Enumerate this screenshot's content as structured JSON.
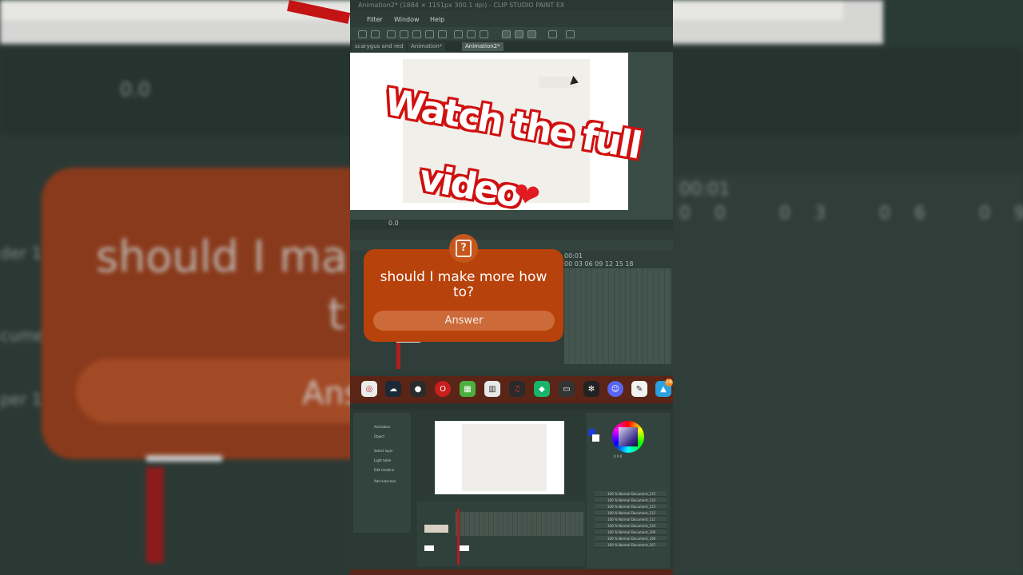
{
  "window": {
    "title": "Animation2* (1884 × 1151px 300.1 dpi) - CLIP STUDIO PAINT EX"
  },
  "menu": [
    "Filter",
    "Window",
    "Help"
  ],
  "tabs": [
    {
      "label": "scarygus and red",
      "active": false
    },
    {
      "label": "Animation*",
      "active": false
    },
    {
      "label": "Animation2*",
      "active": true
    }
  ],
  "overlay": {
    "headline_line1": "Watch the full",
    "headline_line2": "video",
    "heart": "❤"
  },
  "question": {
    "text": "should I make more how to?",
    "answer_label": "Answer",
    "icon": "question-mark-icon"
  },
  "timeline": {
    "time_label": "00:01",
    "ticks": "00 03 06 09 12 15 18",
    "zoom_value": "0.0"
  },
  "background": {
    "question_text_line1": "should I ma",
    "question_text_line2": "t",
    "answer_label": "Ans",
    "ticks": "00 03 06 09 12 15 18",
    "time_label": "00:01",
    "layer_label_1": "der 1",
    "layer_label_2": "cumen",
    "layer_label_3": "per 1",
    "zoom_value": "0.0"
  },
  "taskbar": {
    "icons": [
      "opera-gx-icon",
      "steam-icon",
      "obs-icon",
      "opera-icon",
      "minecraft-icon",
      "app-icon",
      "headphones-icon",
      "greenapp-icon",
      "monitor-icon",
      "resolve-icon",
      "discord-icon",
      "clip-studio-icon",
      "app-badge-icon"
    ],
    "badge_count": "18"
  },
  "mini": {
    "left_rows": [
      "Animation",
      "Object",
      "Select layer",
      "Light table",
      "Edit timeline",
      "Add auto-tool"
    ],
    "layers": [
      "100 % Normal Document_115",
      "100 % Normal Document_114",
      "100 % Normal Document_113",
      "100 % Normal Document_112",
      "100 % Normal Document_111",
      "100 % Normal Document_110",
      "100 % Normal Document_109",
      "100 % Normal Document_108",
      "100 % Normal Document_107"
    ],
    "color_values": "0 0 0"
  },
  "colors": {
    "bubble": "#b8420b",
    "bubble_button": "#cc6a3a",
    "title_red": "#d01010",
    "app_bg": "#2d3c37"
  }
}
